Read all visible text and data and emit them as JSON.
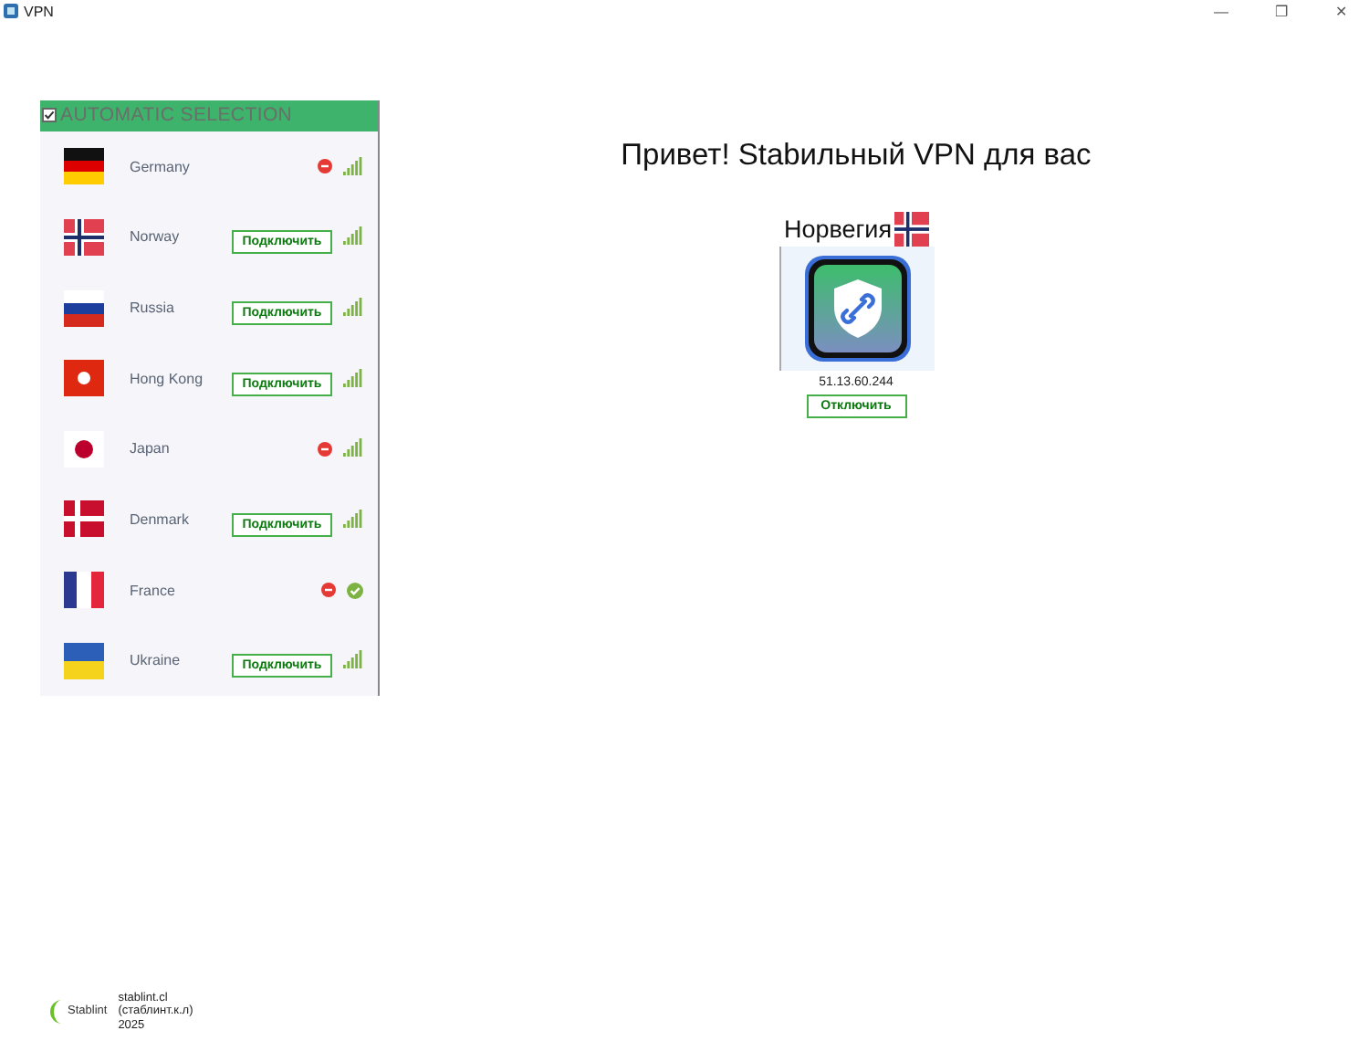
{
  "window": {
    "title": "VPN",
    "controls": [
      "—",
      "❐",
      "✕"
    ]
  },
  "server_list": {
    "header": {
      "label": "AUTOMATIC SELECTION",
      "checked": true
    },
    "servers": [
      {
        "name": "Germany",
        "flag": {
          "kind": "de"
        },
        "action": {
          "kind": "blocked"
        },
        "indicator": {
          "kind": "signal"
        }
      },
      {
        "name": "Norway",
        "flag": {
          "kind": "no"
        },
        "action": {
          "kind": "connect",
          "label": "Подключить"
        },
        "indicator": {
          "kind": "signal"
        }
      },
      {
        "name": "Russia",
        "flag": {
          "kind": "ru"
        },
        "action": {
          "kind": "connect",
          "label": "Подключить"
        },
        "indicator": {
          "kind": "signal"
        }
      },
      {
        "name": "Hong Kong",
        "flag": {
          "kind": "hk"
        },
        "action": {
          "kind": "connect",
          "label": "Подключить"
        },
        "indicator": {
          "kind": "signal"
        }
      },
      {
        "name": "Japan",
        "flag": {
          "kind": "jp"
        },
        "action": {
          "kind": "blocked"
        },
        "indicator": {
          "kind": "signal"
        }
      },
      {
        "name": "Denmark",
        "flag": {
          "kind": "dk"
        },
        "action": {
          "kind": "connect",
          "label": "Подключить"
        },
        "indicator": {
          "kind": "signal"
        }
      },
      {
        "name": "France",
        "flag": {
          "kind": "fr"
        },
        "action": {
          "kind": "blocked"
        },
        "indicator": {
          "kind": "ok"
        }
      },
      {
        "name": "Ukraine",
        "flag": {
          "kind": "ua"
        },
        "action": {
          "kind": "connect",
          "label": "Подключить"
        },
        "indicator": {
          "kind": "signal"
        }
      }
    ]
  },
  "main": {
    "greeting": "Привет! Stabильный VPN для вас",
    "country": "Норвегия",
    "country_flag": {
      "kind": "no"
    },
    "ip": "51.13.60.244",
    "disconnect_label": "Отключить"
  },
  "footer": {
    "logo_text": "Stablint",
    "lines": [
      "stablint.cl",
      "(стаблинт.к.л)",
      "2025"
    ]
  }
}
